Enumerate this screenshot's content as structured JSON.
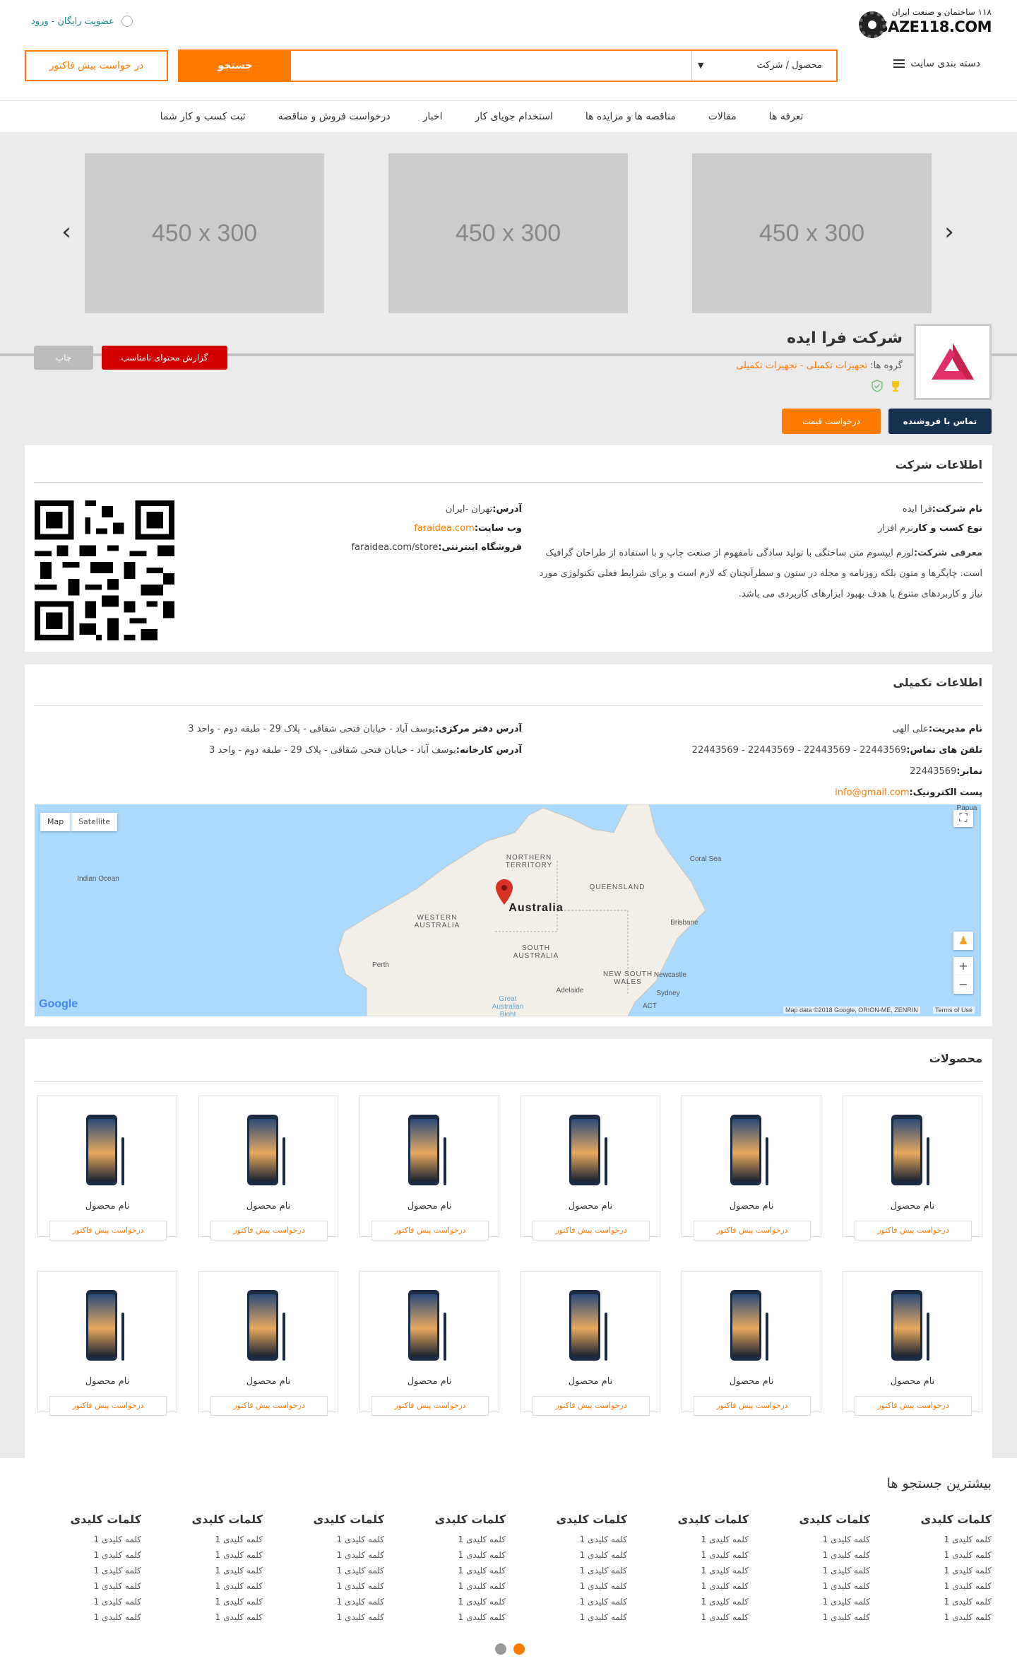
{
  "header": {
    "logo_tagline": "۱۱۸ ساختمان و صنعت ایران",
    "logo_brand": "SAZE118.COM",
    "auth_login": "ورود",
    "auth_sep": "-",
    "auth_register": "عضویت رایگان",
    "category_label": "دسته بندی سایت",
    "search_select": "محصول / شرکت",
    "search_placeholder": "",
    "search_button": "جستجو",
    "quote_button": "در خواست پیش فاکتور"
  },
  "nav": [
    "ثبت کسب و کار شما",
    "درخواست فروش و مناقصه",
    "اخبار",
    "استخدام جویای کار",
    "مناقصه ها و مزایده ها",
    "مقالات",
    "تعرفه ها"
  ],
  "slider": {
    "slides": [
      "450 x 300",
      "450 x 300",
      "450 x 300"
    ]
  },
  "company": {
    "name": "شرکت فرا ایده",
    "groups_label": "گروه ها:",
    "groups_value": "تجهیزات تکمیلی - تجهیزات تکمیلی",
    "report_button": "گزارش محتوای نامناسب",
    "print_button": "چاپ",
    "contact_button": "تماس با فروشنده",
    "price_button": "درخواست قیمت"
  },
  "info": {
    "title": "اطلاعات شرکت",
    "name_label": "نام شرکت:",
    "name_value": "فرا ایده",
    "type_label": "نوع کسب و کار",
    "type_value": "نرم افزار",
    "intro_label": "معرفی شرکت:",
    "intro_value": "لورم ایپسوم متن ساختگی با تولید سادگی نامفهوم از صنعت چاپ و با استفاده از طراحان گرافیک است. چاپگرها و متون بلکه روزنامه و مجله در ستون و سطرآنچنان که لازم است و برای شرایط فعلی تکنولوژی مورد نیاز و کاربردهای متنوع با هدف بهبود ابزارهای کاربردی می باشد.",
    "address_label": "آدرس:",
    "address_value": "تهران -ایران",
    "website_label": "وب سایت:",
    "website_value": "faraidea.com",
    "store_label": "فروشگاه اینترنتی:",
    "store_value": "faraidea.com/store"
  },
  "extra": {
    "title": "اطلاعات تکمیلی",
    "manager_label": "نام مدیریت:",
    "manager_value": "علی الهی",
    "phones_label": "تلفن های تماس:",
    "phones_value": "22443569 - 22443569 - 22443569 - 22443569",
    "fax_label": "نمابر:",
    "fax_value": "22443569",
    "email_label": "پست الکترونیک:",
    "email_value": "info@gmail.com",
    "office_label": "آدرس دفتر مرکزی:",
    "office_value": "یوسف آباد - خیابان فتحی شقاقی - پلاک 29 - طبقه دوم - واحد 3",
    "factory_label": "آدرس کارخانه:",
    "factory_value": "یوسف آباد - خیابان فتحی شقاقی - پلاک 29 - طبقه دوم - واحد 3"
  },
  "map": {
    "tab_map": "Map",
    "tab_satellite": "Satellite",
    "labels": {
      "indian_ocean": "Indian Ocean",
      "northern_territory": "NORTHERN TERRITORY",
      "queensland": "QUEENSLAND",
      "coral_sea": "Coral Sea",
      "australia": "Australia",
      "western_australia": "WESTERN AUSTRALIA",
      "south_australia": "SOUTH AUSTRALIA",
      "new_south_wales": "NEW SOUTH WALES",
      "brisbane": "Brisbane",
      "perth": "Perth",
      "newcastle": "Newcastle",
      "adelaide": "Adelaide",
      "sydney": "Sydney",
      "act": "ACT",
      "bight": "Great Australian Bight",
      "papua": "Papua"
    },
    "google": "Google",
    "attribution": "Map data ©2018 Google, ORION-ME, ZENRIN",
    "terms": "Terms of Use",
    "colors": {
      "water": "#aadaff",
      "land": "#f2efe9",
      "pin": "#d93025"
    }
  },
  "products": {
    "title": "محصولات",
    "items": [
      {
        "name": "نام محصول",
        "button": "درخواست پیش فاکتور"
      },
      {
        "name": "نام محصول",
        "button": "درخواست پیش فاکتور"
      },
      {
        "name": "نام محصول",
        "button": "درخواست پیش فاکتور"
      },
      {
        "name": "نام محصول",
        "button": "درخواست پیش فاکتور"
      },
      {
        "name": "نام محصول",
        "button": "درخواست پیش فاکتور"
      },
      {
        "name": "نام محصول",
        "button": "درخواست پیش فاکتور"
      },
      {
        "name": "نام محصول",
        "button": "درخواست پیش فاکتور"
      },
      {
        "name": "نام محصول",
        "button": "درخواست پیش فاکتور"
      },
      {
        "name": "نام محصول",
        "button": "درخواست پیش فاکتور"
      },
      {
        "name": "نام محصول",
        "button": "درخواست پیش فاکتور"
      },
      {
        "name": "نام محصول",
        "button": "درخواست پیش فاکتور"
      },
      {
        "name": "نام محصول",
        "button": "درخواست پیش فاکتور"
      }
    ]
  },
  "keywords": {
    "title": "بیشترین جستجو ها",
    "columns": [
      {
        "heading": "کلمات کلیدی",
        "items": [
          "کلمه کلیدی 1",
          "کلمه کلیدی 1",
          "کلمه کلیدی 1",
          "کلمه کلیدی 1",
          "کلمه کلیدی 1",
          "کلمه کلیدی 1"
        ]
      },
      {
        "heading": "کلمات کلیدی",
        "items": [
          "کلمه کلیدی 1",
          "کلمه کلیدی 1",
          "کلمه کلیدی 1",
          "کلمه کلیدی 1",
          "کلمه کلیدی 1",
          "کلمه کلیدی 1"
        ]
      },
      {
        "heading": "کلمات کلیدی",
        "items": [
          "کلمه کلیدی 1",
          "کلمه کلیدی 1",
          "کلمه کلیدی 1",
          "کلمه کلیدی 1",
          "کلمه کلیدی 1",
          "کلمه کلیدی 1"
        ]
      },
      {
        "heading": "کلمات کلیدی",
        "items": [
          "کلمه کلیدی 1",
          "کلمه کلیدی 1",
          "کلمه کلیدی 1",
          "کلمه کلیدی 1",
          "کلمه کلیدی 1",
          "کلمه کلیدی 1"
        ]
      },
      {
        "heading": "کلمات کلیدی",
        "items": [
          "کلمه کلیدی 1",
          "کلمه کلیدی 1",
          "کلمه کلیدی 1",
          "کلمه کلیدی 1",
          "کلمه کلیدی 1",
          "کلمه کلیدی 1"
        ]
      },
      {
        "heading": "کلمات کلیدی",
        "items": [
          "کلمه کلیدی 1",
          "کلمه کلیدی 1",
          "کلمه کلیدی 1",
          "کلمه کلیدی 1",
          "کلمه کلیدی 1",
          "کلمه کلیدی 1"
        ]
      },
      {
        "heading": "کلمات کلیدی",
        "items": [
          "کلمه کلیدی 1",
          "کلمه کلیدی 1",
          "کلمه کلیدی 1",
          "کلمه کلیدی 1",
          "کلمه کلیدی 1",
          "کلمه کلیدی 1"
        ]
      },
      {
        "heading": "کلمات کلیدی",
        "items": [
          "کلمه کلیدی 1",
          "کلمه کلیدی 1",
          "کلمه کلیدی 1",
          "کلمه کلیدی 1",
          "کلمه کلیدی 1",
          "کلمه کلیدی 1"
        ]
      }
    ]
  },
  "pager": {
    "count": 2,
    "active": 1
  },
  "colors": {
    "accent": "#ff7a00",
    "navy": "#16304f",
    "danger": "#d30000"
  }
}
